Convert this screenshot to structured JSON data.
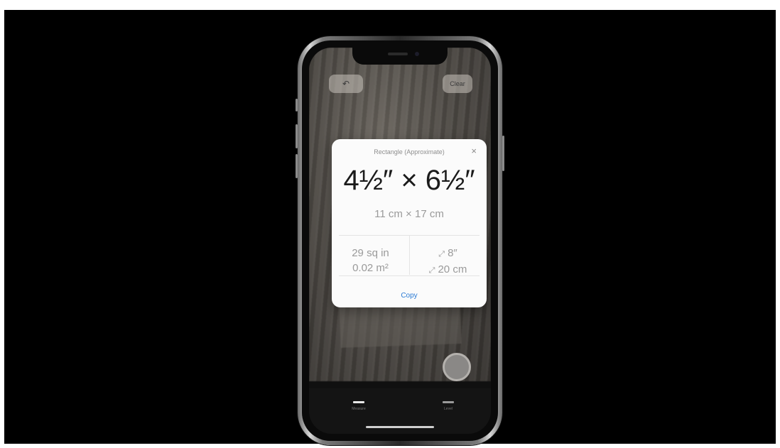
{
  "toolbar": {
    "undo_icon": "undo-arrow-icon",
    "undo_glyph": "↶",
    "clear_label": "Clear"
  },
  "measurement": {
    "title": "Rectangle (Approximate)",
    "close_glyph": "×",
    "primary": "4½″ × 6½″",
    "secondary": "11 cm × 17 cm",
    "area_imperial": "29 sq in",
    "area_metric": "0.02 m²",
    "diagonal_icon": "diagonal-arrows-icon",
    "diagonal_glyph": "⤢",
    "diagonal_imperial": "8″",
    "diagonal_metric": "20 cm",
    "copy_label": "Copy"
  },
  "bottom_tabs": [
    {
      "label": "Measure",
      "active": true
    },
    {
      "label": "Level",
      "active": false
    }
  ],
  "colors": {
    "accent": "#2b7bd4",
    "background": "#000000",
    "card": "#fbfbfb"
  }
}
